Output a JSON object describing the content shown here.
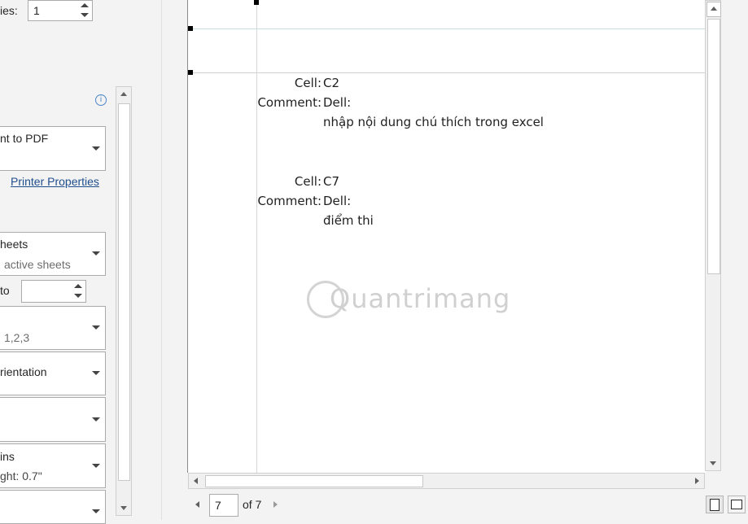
{
  "left_panel": {
    "copies_label": "ies:",
    "copies_value": "1",
    "printer": {
      "name": "nt to PDF",
      "properties_link": "Printer Properties",
      "info_icon": "info-icon"
    },
    "settings": {
      "sheets_title": "heets",
      "sheets_sub": "active sheets",
      "pages_to_label": "to",
      "pages_to_value": "",
      "collate_sub": "1,2,3",
      "orientation_title": "rientation",
      "paper_size_title": "",
      "margins_title": "ins",
      "margins_sub": "ght:  0.7\""
    }
  },
  "preview": {
    "comments": [
      {
        "cell_label": "Cell:",
        "cell_value": "C2",
        "comment_label": "Comment:",
        "author": "Dell:",
        "text": "nhập nội dung chú thích trong excel"
      },
      {
        "cell_label": "Cell:",
        "cell_value": "C7",
        "comment_label": "Comment:",
        "author": "Dell:",
        "text": "điểm thi"
      }
    ],
    "watermark": "Quantrimang"
  },
  "pager": {
    "current_page": "7",
    "of_label": "of 7"
  },
  "colors": {
    "panel_bg": "#f3f3f3",
    "link": "#1f4e8c",
    "page_bg": "#ffffff",
    "watermark": "#c9c9c9"
  },
  "icons": {
    "show_margins": "show-margins-icon",
    "zoom_to_page": "zoom-to-page-icon",
    "prev_page": "caret-left-icon",
    "next_page": "caret-right-icon"
  }
}
